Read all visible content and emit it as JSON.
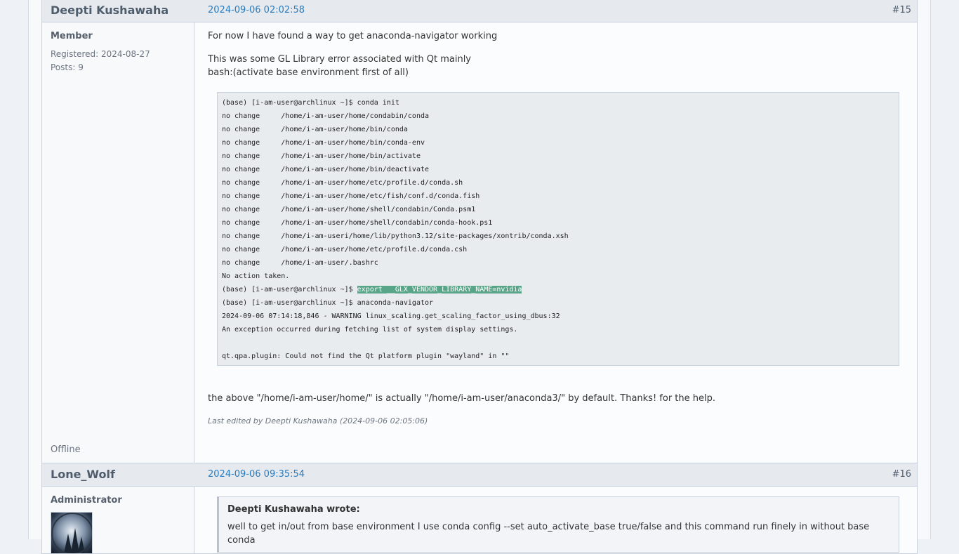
{
  "posts": [
    {
      "author": "Deepti Kushawaha",
      "date": "2024-09-06 02:02:58",
      "number": "#15",
      "role": "Member",
      "registered": "Registered: 2024-08-27",
      "posts": "Posts: 9",
      "status": "Offline",
      "paragraph1": "For now I have found a way to get anaconda-navigator working",
      "paragraph2_line1": "This was some GL Library  error associated with Qt mainly",
      "paragraph2_line2": "bash:(activate base environment first of all)",
      "code": {
        "lines": [
          "(base) [i-am-user@archlinux ~]$ conda init",
          "no change     /home/i-am-user/home/condabin/conda",
          "no change     /home/i-am-user/home/bin/conda",
          "no change     /home/i-am-user/home/bin/conda-env",
          "no change     /home/i-am-user/home/bin/activate",
          "no change     /home/i-am-user/home/bin/deactivate",
          "no change     /home/i-am-user/home/etc/profile.d/conda.sh",
          "no change     /home/i-am-user/home/etc/fish/conf.d/conda.fish",
          "no change     /home/i-am-user/home/shell/condabin/Conda.psm1",
          "no change     /home/i-am-user/home/shell/condabin/conda-hook.ps1",
          "no change     /home/i-am-useri/home/lib/python3.12/site-packages/xontrib/conda.xsh",
          "no change     /home/i-am-user/home/etc/profile.d/conda.csh",
          "no change     /home/i-am-user/.bashrc",
          "No action taken."
        ],
        "export_prompt": "(base) [i-am-user@archlinux ~]$ ",
        "export_command": "export __GLX_VENDOR_LIBRARY_NAME=nvidia",
        "lines_after": [
          "(base) [i-am-user@archlinux ~]$ anaconda-navigator",
          "2024-09-06 07:14:18,846 - WARNING linux_scaling.get_scaling_factor_using_dbus:32",
          "An exception occurred during fetching list of system display settings.",
          "",
          "qt.qpa.plugin: Could not find the Qt platform plugin \"wayland\" in \"\""
        ]
      },
      "paragraph3": "the above \"/home/i-am-user/home/\" is actually \"/home/i-am-user/anaconda3/\" by default. Thanks! for the help.",
      "edited": "Last edited by Deepti Kushawaha (2024-09-06 02:05:06)"
    },
    {
      "author": "Lone_Wolf",
      "date": "2024-09-06 09:35:54",
      "number": "#16",
      "role": "Administrator",
      "quote_author": "Deepti Kushawaha wrote:",
      "quote_text": "well to get in/out from base environment I use conda config --set auto_activate_base true/false  and this command run finely in without base conda"
    }
  ]
}
